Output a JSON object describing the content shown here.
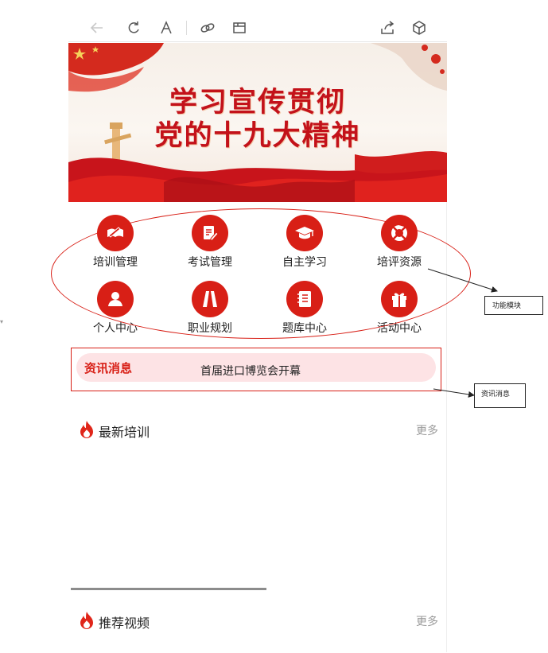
{
  "toolbar": {
    "icons": [
      "back-arrow-icon",
      "refresh-icon",
      "font-icon",
      "link-icon",
      "window-icon",
      "share-icon",
      "cube-icon"
    ]
  },
  "banner": {
    "line1": "学习宣传贯彻",
    "line2": "党的十九大精神"
  },
  "modules": [
    {
      "label": "培训管理",
      "icon": "book-pen-icon"
    },
    {
      "label": "考试管理",
      "icon": "exam-edit-icon"
    },
    {
      "label": "自主学习",
      "icon": "graduation-cap-icon"
    },
    {
      "label": "培评资源",
      "icon": "lifebuoy-icon"
    },
    {
      "label": "个人中心",
      "icon": "user-icon"
    },
    {
      "label": "职业规划",
      "icon": "road-icon"
    },
    {
      "label": "题库中心",
      "icon": "notebook-icon"
    },
    {
      "label": "活动中心",
      "icon": "gift-icon"
    }
  ],
  "news": {
    "title": "资讯消息",
    "headline": "首届进口博览会开幕"
  },
  "annotations": {
    "modules_label": "功能模块",
    "news_label": "资讯消息"
  },
  "sections": {
    "training": {
      "title": "最新培训",
      "more": "更多"
    },
    "videos": {
      "title": "推荐视频",
      "more": "更多"
    }
  },
  "colors": {
    "accent": "#d81f16",
    "news_bg": "#fde3e5"
  }
}
